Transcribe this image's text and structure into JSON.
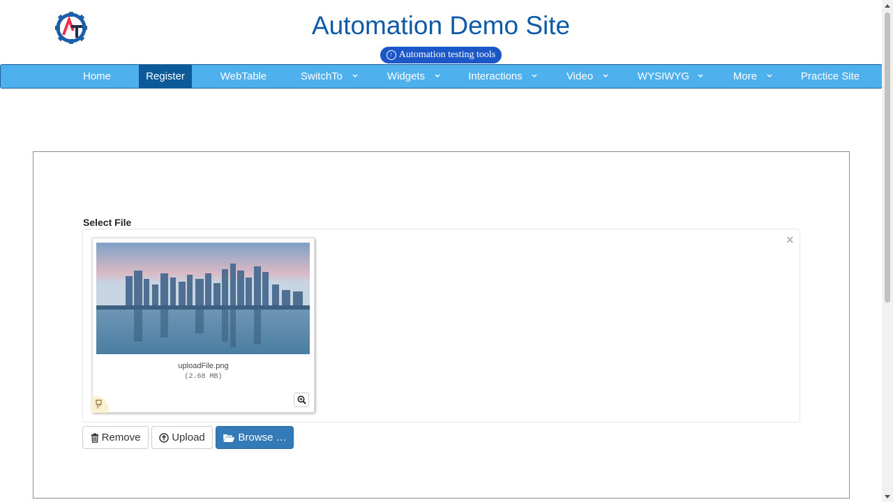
{
  "header": {
    "title": "Automation Demo Site",
    "tools_button": "Automation testing tools",
    "logo_letters": "AT"
  },
  "nav": {
    "items": [
      {
        "label": "Home"
      },
      {
        "label": "Register"
      },
      {
        "label": "WebTable"
      },
      {
        "label": "SwitchTo"
      },
      {
        "label": "Widgets"
      },
      {
        "label": "Interactions"
      },
      {
        "label": "Video"
      },
      {
        "label": "WYSIWYG"
      },
      {
        "label": "More"
      },
      {
        "label": "Practice Site"
      }
    ],
    "active": "Register"
  },
  "upload": {
    "label": "Select File",
    "file_name": "uploadFile.png",
    "file_size": "(2.68 MB)",
    "remove_label": "Remove",
    "upload_label": "Upload",
    "browse_label": "Browse …"
  },
  "colors": {
    "nav_bg": "#4fb0ee",
    "nav_active": "#0d5a9a",
    "title": "#0d5aa7",
    "pill": "#1c57c8",
    "primary_button": "#337ab7"
  }
}
